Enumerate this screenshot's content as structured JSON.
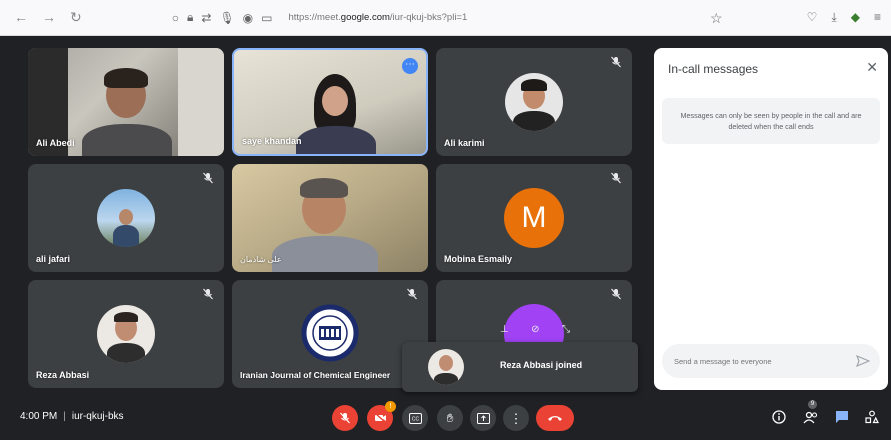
{
  "browser": {
    "url_prefix": "https://meet.",
    "url_domain": "google.com",
    "url_suffix": "/iur-qkuj-bks?pli=1"
  },
  "tiles": [
    {
      "name": "Ali Abedi"
    },
    {
      "name": "saye khandan"
    },
    {
      "name": "Ali karimi"
    },
    {
      "name": "ali jafari"
    },
    {
      "name": "علی شادمان"
    },
    {
      "name": "Mobina Esmaily",
      "initial": "M"
    },
    {
      "name": "Reza Abbasi"
    },
    {
      "name": "Iranian Journal of Chemical Engineer"
    }
  ],
  "notification": {
    "text": "Reza Abbasi joined"
  },
  "chat_panel": {
    "title": "In-call messages",
    "info": "Messages can only be seen by people in the call and are deleted when the call ends",
    "input_placeholder": "Send a message to everyone"
  },
  "bottom_bar": {
    "time": "4:00 PM",
    "meeting_code": "iur-qkuj-bks",
    "people_count": "9",
    "reactions_badge": "!"
  },
  "colors": {
    "background": "#202124",
    "tile": "#3c4043",
    "accent_red": "#ea4335",
    "accent_blue": "#4285f4",
    "avatar_orange": "#e8710a",
    "avatar_purple": "#a142f4"
  }
}
